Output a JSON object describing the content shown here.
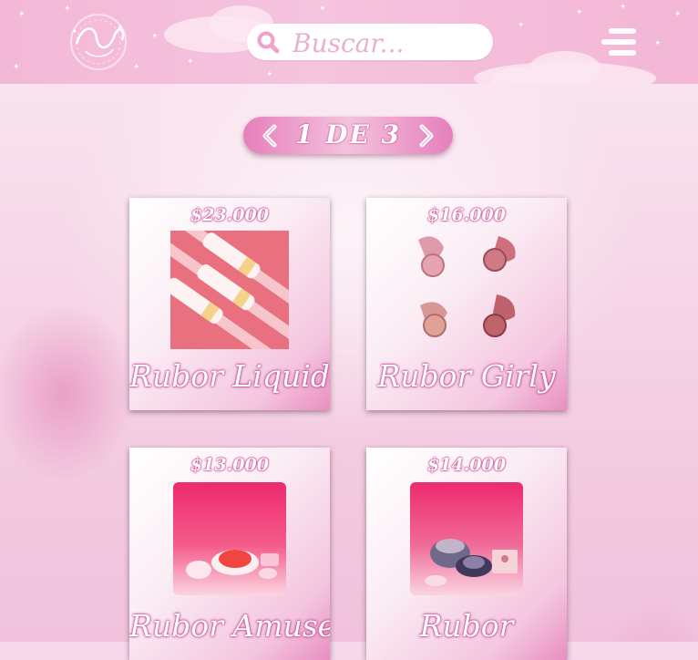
{
  "header": {
    "logo_alt": "",
    "search": {
      "placeholder": "Buscar...",
      "value": ""
    },
    "menu_icon": "hamburger-menu-icon"
  },
  "pagination": {
    "current": 1,
    "total": 3,
    "label": "1 DE 3"
  },
  "colors": {
    "header_pink": "#f3b8d6",
    "accent_pink": "#e67fbb",
    "text_outline": "#c13e8b",
    "background": "#f6d8ea"
  },
  "products": [
    {
      "price": "$23.000",
      "name": "Rubor Liquido",
      "image": "liquid-blush-tubes"
    },
    {
      "price": "$16.000",
      "name": "Rubor Girly",
      "image": "powder-blush-compacts"
    },
    {
      "price": "$13.000",
      "name": "Rubor Amuse",
      "image": "amuse-blush-jar"
    },
    {
      "price": "$14.000",
      "name": "Rubor",
      "image": "blush-jar-set"
    }
  ]
}
